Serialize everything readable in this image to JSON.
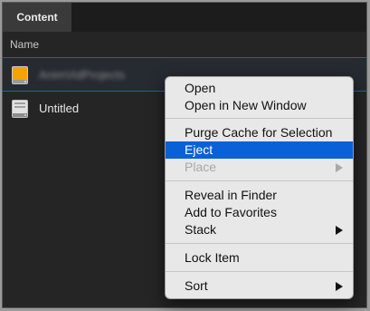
{
  "tabs": [
    {
      "label": "Content"
    }
  ],
  "columns": {
    "name": "Name"
  },
  "items": [
    {
      "label": "AnimVidProjects",
      "icon": "external-drive-orange-icon",
      "selected": true
    },
    {
      "label": "Untitled",
      "icon": "disk-image-icon",
      "selected": false
    }
  ],
  "context_menu": {
    "groups": [
      [
        {
          "label": "Open"
        },
        {
          "label": "Open in New Window"
        }
      ],
      [
        {
          "label": "Purge Cache for Selection"
        },
        {
          "label": "Eject",
          "highlighted": true
        },
        {
          "label": "Place",
          "disabled": true,
          "submenu": true
        }
      ],
      [
        {
          "label": "Reveal in Finder"
        },
        {
          "label": "Add to Favorites"
        },
        {
          "label": "Stack",
          "submenu": true
        }
      ],
      [
        {
          "label": "Lock Item"
        }
      ],
      [
        {
          "label": "Sort",
          "submenu": true
        }
      ]
    ]
  },
  "colors": {
    "highlight": "#0a61d6",
    "selection_border": "#2b5f9e",
    "background": "#252525"
  }
}
